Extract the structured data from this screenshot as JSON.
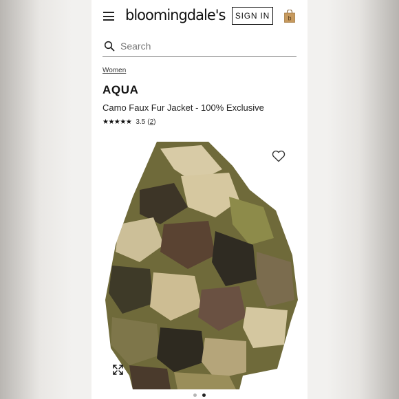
{
  "header": {
    "logo_text": "bloomingdale's",
    "sign_in_label": "SIGN IN",
    "menu_icon": "hamburger-menu-icon",
    "bag_icon": "shopping-bag-icon",
    "bag_badge_letter": "b"
  },
  "search": {
    "placeholder": "Search",
    "value": "",
    "icon": "search-icon"
  },
  "breadcrumb": "Women",
  "product": {
    "brand": "AQUA",
    "name": "Camo Faux Fur Jacket - 100% Exclusive",
    "stars_display": "★★★★★",
    "rating": "3.5",
    "review_count": "2",
    "favorite_icon": "heart-icon",
    "expand_icon": "expand-icon"
  },
  "carousel": {
    "total_images": 2,
    "active_index": 1
  },
  "colors": {
    "accent": "#111111",
    "bag": "#c79a5e"
  }
}
